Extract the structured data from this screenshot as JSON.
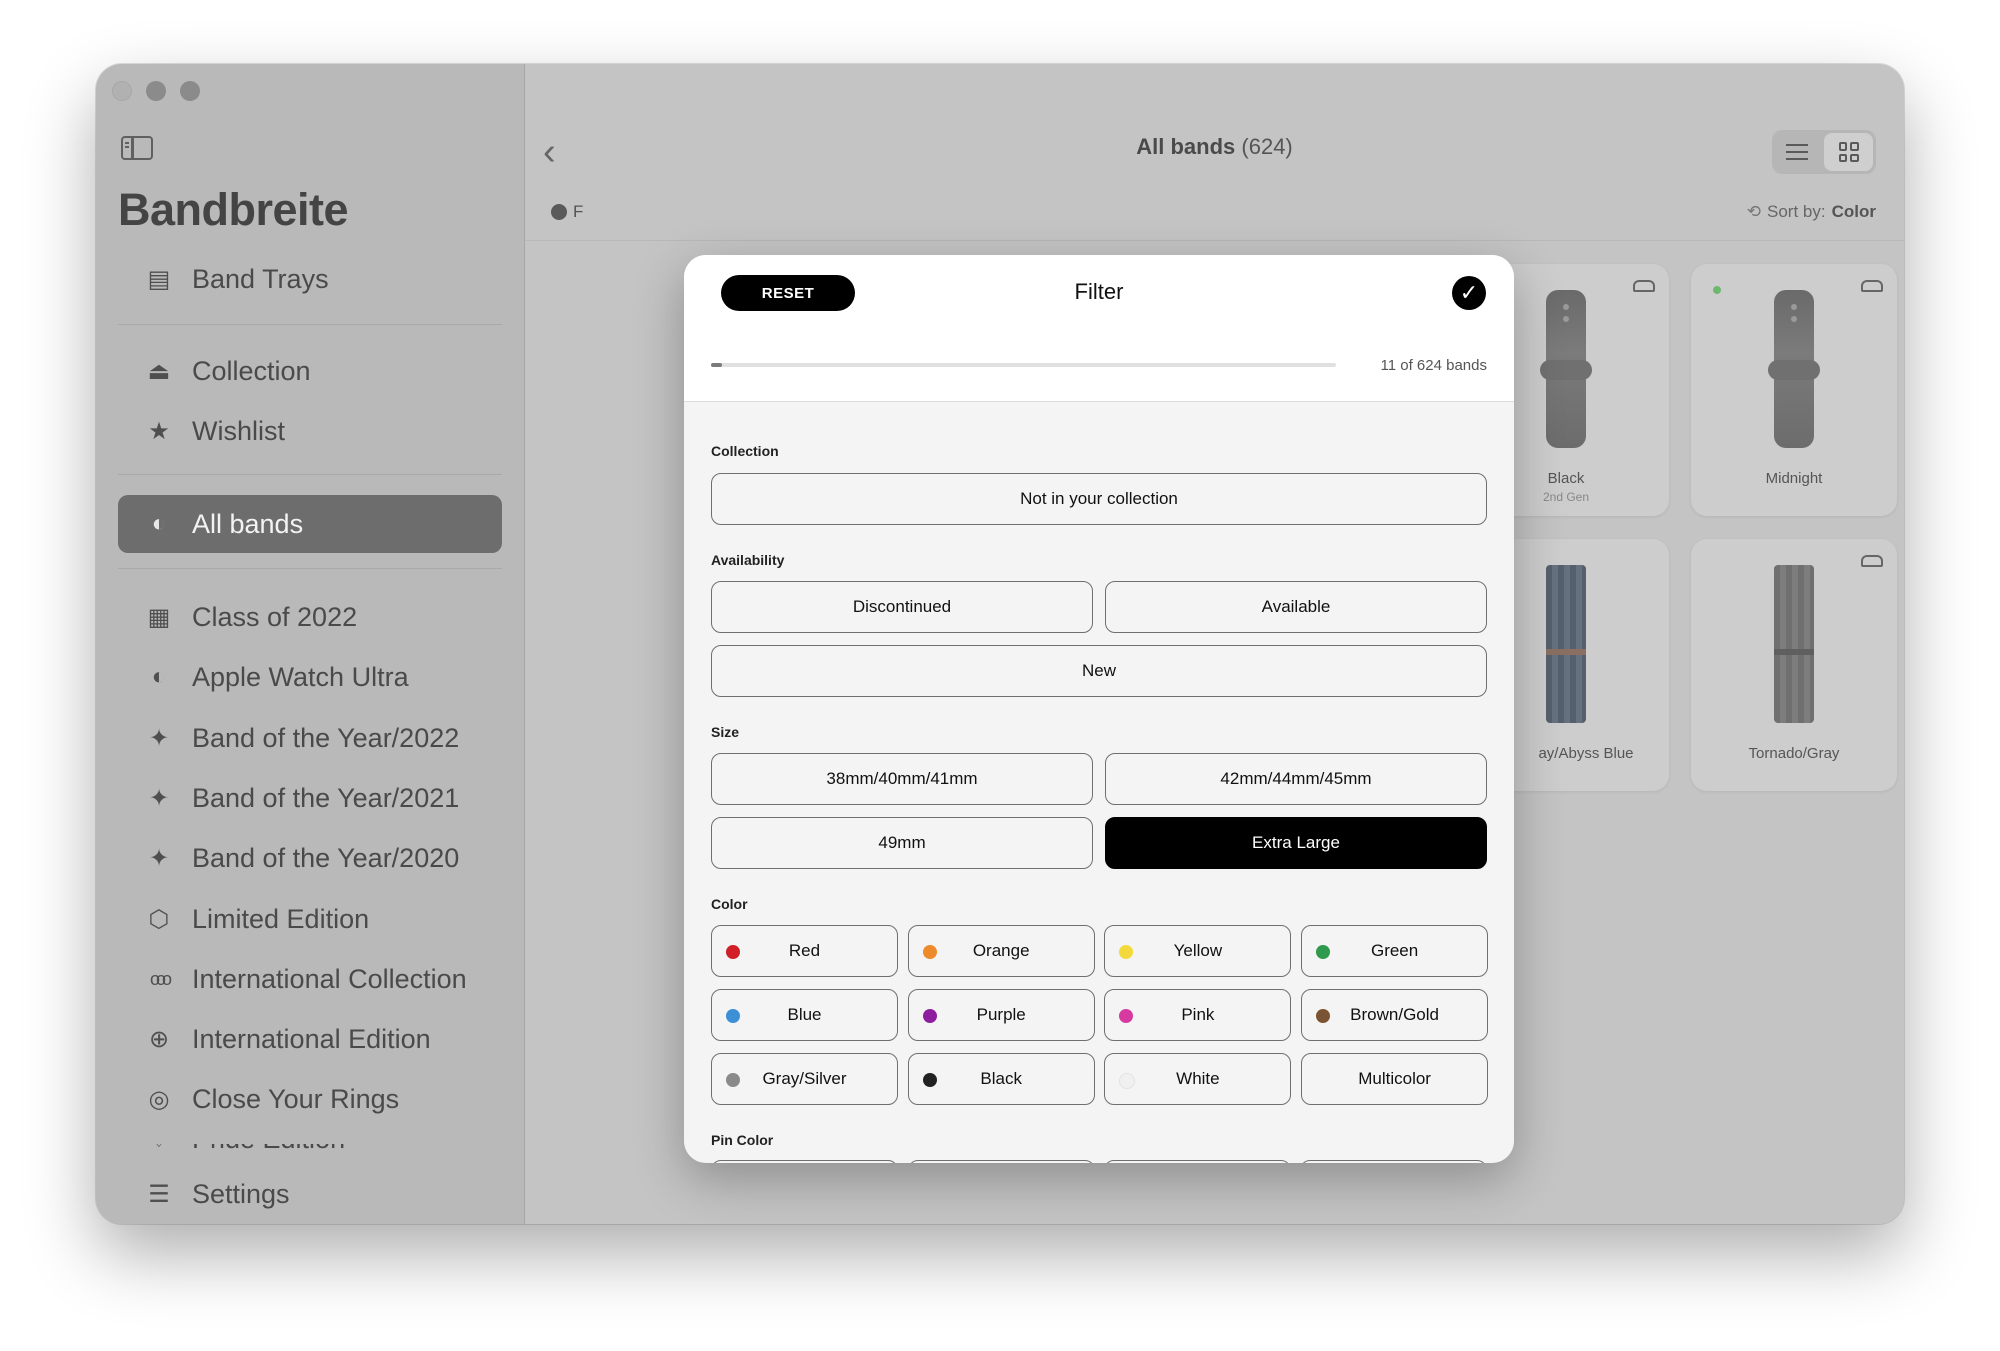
{
  "app": {
    "title": "Bandbreite"
  },
  "sidebar": {
    "items": [
      {
        "label": "Band Trays",
        "icon": "band-tray-icon"
      },
      {
        "label": "Collection",
        "icon": "collection-tray-icon"
      },
      {
        "label": "Wishlist",
        "icon": "star-icon"
      },
      {
        "label": "All bands",
        "icon": "watch-icon",
        "active": true
      },
      {
        "label": "Class of 2022",
        "icon": "calendar-icon"
      },
      {
        "label": "Apple Watch Ultra",
        "icon": "watch-icon"
      },
      {
        "label": "Band of the Year/2022",
        "icon": "sparkle-icon"
      },
      {
        "label": "Band of the Year/2021",
        "icon": "sparkle-icon"
      },
      {
        "label": "Band of the Year/2020",
        "icon": "sparkle-icon"
      },
      {
        "label": "Limited Edition",
        "icon": "box-icon"
      },
      {
        "label": "International Collection",
        "icon": "rings-icon"
      },
      {
        "label": "International Edition",
        "icon": "globe-icon"
      },
      {
        "label": "Close Your Rings",
        "icon": "activity-rings-icon"
      },
      {
        "label": "Pride Edition",
        "icon": "heart-icon"
      }
    ],
    "settings_label": "Settings"
  },
  "main": {
    "title": "All bands",
    "count": "(624)",
    "filter_chip": "F",
    "sort_label": "Sort by:",
    "sort_value": "Color",
    "cards": [
      {
        "name": "Black",
        "sub": "2nd Gen"
      },
      {
        "name": "Midnight",
        "sub": ""
      },
      {
        "name": "ay/Abyss Blue",
        "sub": ""
      },
      {
        "name": "Tornado/Gray",
        "sub": ""
      }
    ]
  },
  "filter": {
    "title": "Filter",
    "reset_label": "RESET",
    "progress": {
      "matched": 11,
      "total": 624,
      "text": "11 of 624 bands"
    },
    "collection": {
      "label": "Collection",
      "options": [
        "Not in your collection"
      ]
    },
    "availability": {
      "label": "Availability",
      "options": [
        "Discontinued",
        "Available",
        "New"
      ]
    },
    "size": {
      "label": "Size",
      "options": [
        "38mm/40mm/41mm",
        "42mm/44mm/45mm",
        "49mm",
        "Extra Large"
      ],
      "selected": "Extra Large"
    },
    "color": {
      "label": "Color",
      "options": [
        {
          "label": "Red",
          "color": "#d11f28"
        },
        {
          "label": "Orange",
          "color": "#ef8a2b"
        },
        {
          "label": "Yellow",
          "color": "#f4d93a"
        },
        {
          "label": "Green",
          "color": "#2e9a4e"
        },
        {
          "label": "Blue",
          "color": "#3d8fd6"
        },
        {
          "label": "Purple",
          "color": "#8e1ea0"
        },
        {
          "label": "Pink",
          "color": "#d63aa0"
        },
        {
          "label": "Brown/Gold",
          "color": "#7c5332"
        },
        {
          "label": "Gray/Silver",
          "color": "#8a8a8a"
        },
        {
          "label": "Black",
          "color": "#222222"
        },
        {
          "label": "White",
          "color": "#f0f0f0"
        },
        {
          "label": "Multicolor",
          "color": ""
        }
      ]
    },
    "pin_color": {
      "label": "Pin Color"
    }
  }
}
